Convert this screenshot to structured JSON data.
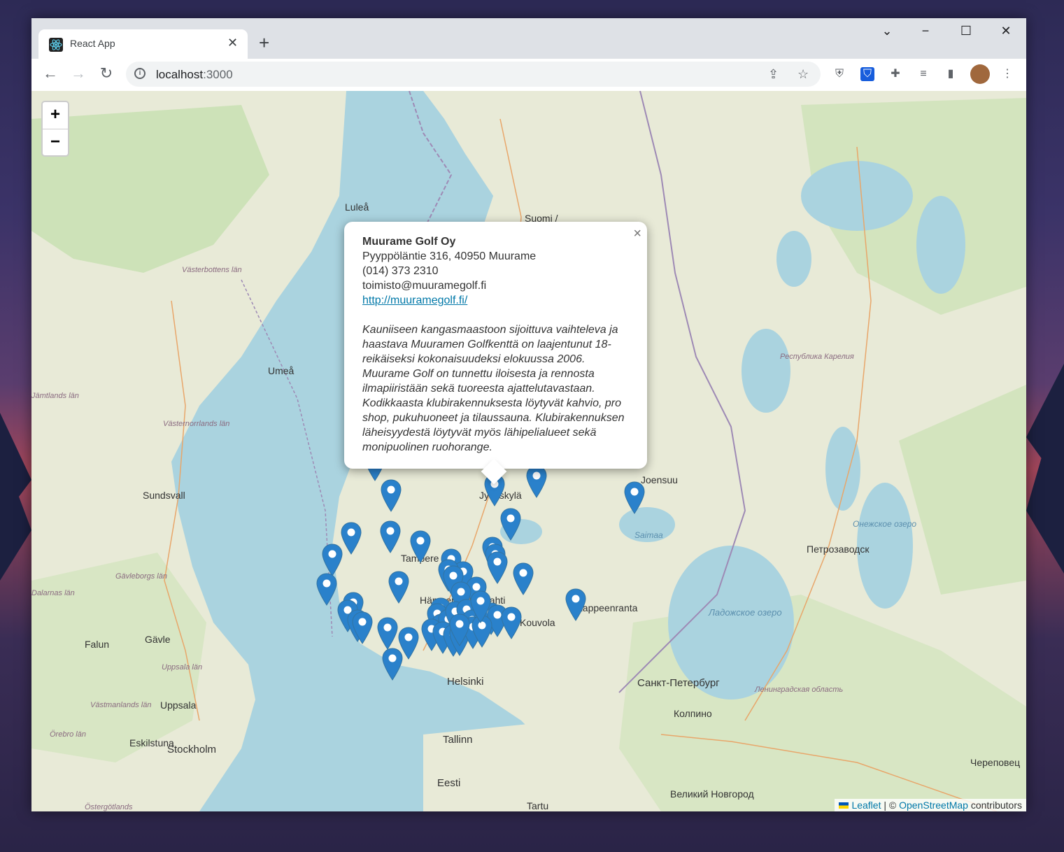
{
  "browser": {
    "tab_title": "React App",
    "url_host": "localhost",
    "url_port": ":3000"
  },
  "map": {
    "zoom_in": "+",
    "zoom_out": "−",
    "labels": [
      {
        "text": "Luleå",
        "cls": "city"
      },
      {
        "text": "Suomi /",
        "cls": "city"
      },
      {
        "text": "Västerbottens län",
        "cls": "region"
      },
      {
        "text": "Umeå",
        "cls": "city"
      },
      {
        "text": "Республика Карелия",
        "cls": "region"
      },
      {
        "text": "Västernorrlands län",
        "cls": "region"
      },
      {
        "text": "Sundsvall",
        "cls": "city"
      },
      {
        "text": "Joensuu",
        "cls": "city"
      },
      {
        "text": "Jyväskylä",
        "cls": "city"
      },
      {
        "text": "Saimaa",
        "cls": "water"
      },
      {
        "text": "Онежское озеро",
        "cls": "water"
      },
      {
        "text": "Петрозаводск",
        "cls": "city"
      },
      {
        "text": "Gävleborgs län",
        "cls": "region"
      },
      {
        "text": "Tampere",
        "cls": "city"
      },
      {
        "text": "Hämeenlinna",
        "cls": "city"
      },
      {
        "text": "Lahti",
        "cls": "city"
      },
      {
        "text": "Lappeenranta",
        "cls": "city"
      },
      {
        "text": "Kouvola",
        "cls": "city"
      },
      {
        "text": "Ладожское озеро",
        "cls": "water"
      },
      {
        "text": "Falun",
        "cls": "city"
      },
      {
        "text": "Gävle",
        "cls": "city"
      },
      {
        "text": "Uppsala län",
        "cls": "region"
      },
      {
        "text": "Helsinki",
        "cls": "city"
      },
      {
        "text": "Санкт-Петербург",
        "cls": "city"
      },
      {
        "text": "Ленинградская область",
        "cls": "region"
      },
      {
        "text": "Västmanlands län",
        "cls": "region"
      },
      {
        "text": "Uppsala",
        "cls": "city"
      },
      {
        "text": "Колпино",
        "cls": "city"
      },
      {
        "text": "Örebro län",
        "cls": "region"
      },
      {
        "text": "Eskilstuna",
        "cls": "city"
      },
      {
        "text": "Stockholm",
        "cls": "city"
      },
      {
        "text": "Tallinn",
        "cls": "city"
      },
      {
        "text": "Eesti",
        "cls": "city"
      },
      {
        "text": "Череповец",
        "cls": "city"
      },
      {
        "text": "Великий Новгород",
        "cls": "city"
      },
      {
        "text": "Tartu",
        "cls": "city"
      },
      {
        "text": "Östergötlands",
        "cls": "region"
      },
      {
        "text": "Dalarnas län",
        "cls": "region"
      },
      {
        "text": "Jämtlands län",
        "cls": "region"
      }
    ],
    "attribution": {
      "leaflet": "Leaflet",
      "sep": " | © ",
      "osm": "OpenStreetMap",
      "contributors": " contributors"
    }
  },
  "popup": {
    "name": "Muurame Golf Oy",
    "address": "Pyyppöläntie 316, 40950 Muurame",
    "phone": "(014) 373 2310",
    "email": "toimisto@muuramegolf.fi",
    "website": "http://muuramegolf.fi/",
    "description": "Kauniiseen kangasmaastoon sijoittuva vaihteleva ja haastava Muuramen Golfkenttä on laajentunut 18-reikäiseksi kokonaisuudeksi elokuussa 2006. Muurame Golf on tunnettu iloisesta ja rennosta ilmapiiristään sekä tuoreesta ajattelutavastaan. Kodikkaasta klubirakennuksesta löytyvät kahvio, pro shop, pukuhuoneet ja tilaussauna. Klubirakennuksen läheisyydestä löytyvät myös lähipelialueet sekä monipuolinen ruohorange.",
    "close": "×"
  },
  "colors": {
    "marker": "#2a81cb",
    "marker_dark": "#3274a3",
    "sea": "#aad3df",
    "land": "#e8ead7",
    "forest": "#cde2b8"
  }
}
